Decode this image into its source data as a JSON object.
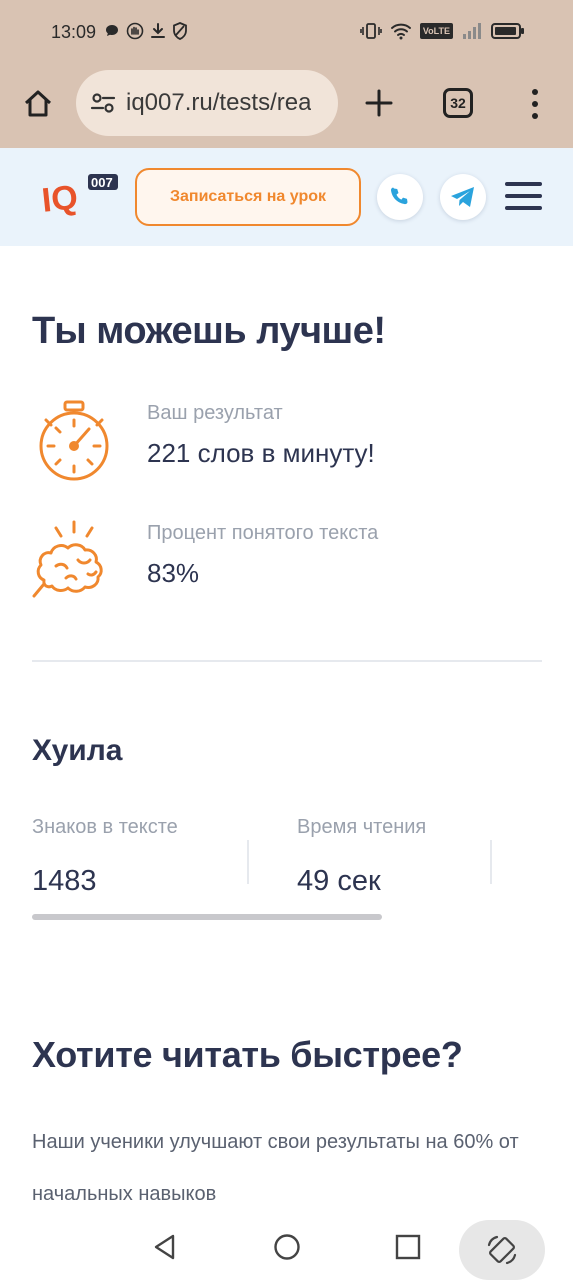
{
  "status_bar": {
    "time": "13:09",
    "left_icons": [
      "chat-bubble-icon",
      "hand-icon",
      "download-icon",
      "shield-icon"
    ],
    "right_icons": [
      "vibrate-icon",
      "wifi-icon",
      "volte-icon",
      "signal-icon",
      "battery-icon"
    ],
    "volte_label": "VoLTE"
  },
  "browser": {
    "url": "iq007.ru/tests/rea",
    "tab_count": "32"
  },
  "site_header": {
    "logo_text": "IQ",
    "logo_sup": "007",
    "signup_label": "Записаться на урок"
  },
  "result": {
    "title": "Ты можешь лучше!",
    "speed_label": "Ваш результат",
    "speed_value": "221 слов в минуту!",
    "comprehension_label": "Процент понятого текста",
    "comprehension_value": "83%"
  },
  "text_info": {
    "title": "Хуила",
    "chars_label": "Знаков в тексте",
    "chars_value": "1483",
    "time_label": "Время чтения",
    "time_value": "49 сек"
  },
  "cta": {
    "title": "Хотите читать быстрее?",
    "text": "Наши ученики улучшают свои результаты на 60% от начальных навыков"
  },
  "colors": {
    "accent": "#f0882e",
    "telegram": "#2aa3dd",
    "text_dark": "#2d3450",
    "header_bg": "#eaf3fb",
    "chrome_bg": "#d9c3b3"
  }
}
